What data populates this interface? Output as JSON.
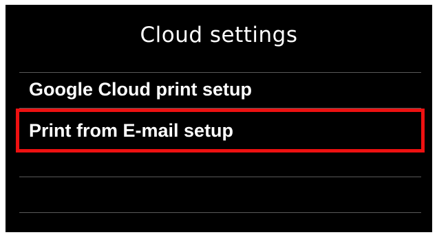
{
  "screen": {
    "title": "Cloud settings"
  },
  "menu": {
    "items": [
      {
        "label": "Google Cloud print setup",
        "selected": false
      },
      {
        "label": "Print from E-mail setup",
        "selected": true
      }
    ]
  },
  "colors": {
    "background": "#000000",
    "text": "#ffffff",
    "highlight": "#ee1111",
    "divider": "#5a5a5a"
  }
}
